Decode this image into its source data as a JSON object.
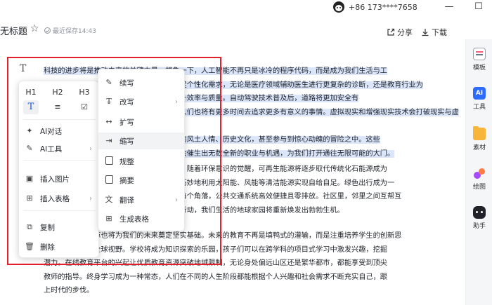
{
  "topbar": {
    "phone": "+86 173****7658",
    "minimize": "—",
    "maximize": "☐"
  },
  "header": {
    "title": "无标题",
    "saved": "最近保存14:43",
    "share": "分享",
    "download": "下载"
  },
  "sidebar": {
    "items": [
      {
        "label": "模板",
        "icon": "template-icon"
      },
      {
        "label": "工具",
        "icon": "ai-icon"
      },
      {
        "label": "素材",
        "icon": "folder-icon"
      },
      {
        "label": "绘图",
        "icon": "draw-icon"
      },
      {
        "label": "助手",
        "icon": "assistant-icon"
      }
    ]
  },
  "document": {
    "para1_prefix": "科技的进步将是",
    "para1_line1": "推动未来的关键力量。想象一下，人工智能不再只是冰冷的程序代码，而是成为我们生活与工",
    "para1_line2": "作中的得力助手，为我们处理日常事务、满足个性化需求，无论是医疗领域辅助医生进行更复杂的诊断，还是教育行业为",
    "para1_line3": "学生提供个性化的学习方案，都将极大地提升效率与质量。自动驾驶技术普及后，道路将更加安全有",
    "para1_line4": "序，交通效率大幅提高，让出行更加便捷，人们也将有更多时间去追求更多有意义的事情。虚拟现实和增强现实技术会打破现实与虚拟世",
    "para1_line5": "界的界限，人们足不出户就能游览世界各地的风土人情、历史文化，甚至参与到惊心动魄的冒险之中。这些",
    "para1_line6": "科技的发展不仅会改变我们的生活方式，还会催生出无数全新的职业与机遇，为我们打开通往无限可能的大门。",
    "para2_line1": "其次，环境保护将成为全球共同关注的核心。随着环保意识的觉醒，可再生能源将逐步取代传统化石能源成为",
    "para2_line2": "主要的能源供应方式。我们将看到更多城市巧妙地利用太阳能、风能等清洁能源实现自给自足。绿色出行成为一",
    "para2_line3": "种时尚，城市绿化面积将不断扩大至城市的每个角落，公共交通系统高效便捷且零排放。社区里，邻里之间互帮互",
    "para2_line4": "助，共同守护着我们的家园，大家都会自觉行动，我们生活的地球家园将重新焕发出勃勃生机。",
    "para3_line1": "此外，教育的变革也将为我们的未来奠定坚实基础。未来的教育不再是填鸭式的灌输，而是注重培养学生的创新思",
    "para3_line2": "维、实践能力和全球视野。学校将成为知识探索的乐园，孩子们可以在跨学科的项目式学习中激发兴趣，挖掘",
    "para3_line3": "潜力。在线教育平台的兴起让优质教育资源突破地域限制，无论身处偏远山区还是繁华都市，都能享受到顶尖",
    "para3_line4": "教师的指导。终身学习成为一种常态，人们在不同的人生阶段都能根据个人兴趣和社会需求不断充实自己，跟",
    "para3_line5": "上时代的步伐。"
  },
  "menu_main": {
    "formats": [
      "H1",
      "H2",
      "H3",
      "T",
      "≡",
      "☑"
    ],
    "items": [
      {
        "label": "AI对话",
        "icon": "sparkle-icon",
        "submenu": false
      },
      {
        "label": "AI工具",
        "icon": "pen-icon",
        "submenu": true
      },
      {
        "label": "插入图片",
        "icon": "image-icon",
        "submenu": false
      },
      {
        "label": "插入表格",
        "icon": "table-icon",
        "submenu": true
      },
      {
        "label": "复制",
        "icon": "copy-icon",
        "submenu": false
      },
      {
        "label": "删除",
        "icon": "trash-icon",
        "submenu": false
      }
    ]
  },
  "menu_sub": {
    "items": [
      {
        "label": "续写",
        "icon": "pen-icon",
        "submenu": false
      },
      {
        "label": "改写",
        "icon": "clear-format-icon",
        "submenu": true
      },
      {
        "label": "扩写",
        "icon": "expand-icon",
        "submenu": false
      },
      {
        "label": "缩写",
        "icon": "shrink-icon",
        "submenu": false,
        "hover": true
      },
      {
        "label": "规整",
        "icon": "tidy-icon",
        "submenu": false
      },
      {
        "label": "摘要",
        "icon": "summary-icon",
        "submenu": false
      },
      {
        "label": "翻译",
        "icon": "translate-icon",
        "submenu": true
      },
      {
        "label": "生成表格",
        "icon": "table-plus-icon",
        "submenu": false
      }
    ]
  },
  "colors": {
    "highlight": "#dbe6fb",
    "accent": "#1456f0",
    "annotation": "#e0202a"
  }
}
